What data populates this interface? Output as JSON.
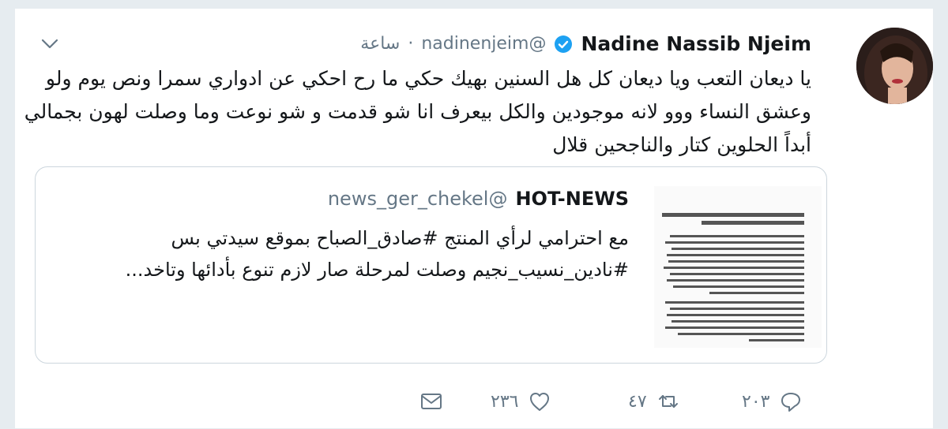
{
  "tweet": {
    "author_name": "Nadine Nassib Njeim",
    "handle": "@nadinenjeim",
    "separator": "·",
    "time": "ساعة",
    "text": "يا ديعان التعب ويا ديعان كل هل السنين بهيك حكي ما رح احكي عن ادواري سمرا ونص يوم ولو وعشق النساء ووو لانه موجودين والكل بيعرف انا شو قدمت و شو نوعت وما وصلت لهون بجمالي أبداً الحلوين كتار والناجحين قلال",
    "icons": {
      "menu": "chevron-down-icon",
      "verified": "verified-badge-icon",
      "avatar": "profile-photo"
    }
  },
  "quoted": {
    "author_name": "HOT-NEWS",
    "handle": "@news_ger_chekel",
    "text": "مع احترامي لرأي المنتج #صادق_الصباح بموقع سيدتي بس #نادين_نسيب_نجيم وصلت لمرحلة صار لازم تنوع بأدائها وتاخد...",
    "thumbnail": "article-text-thumbnail"
  },
  "actions": {
    "reply_count": "٢٠٣",
    "retweet_count": "٤٧",
    "like_count": "٢٣٦",
    "icons": [
      "reply-icon",
      "retweet-icon",
      "like-icon",
      "message-icon"
    ]
  },
  "colors": {
    "text": "#14171a",
    "secondary": "#657786",
    "verified": "#1da1f2",
    "border": "#e6ecf0"
  }
}
